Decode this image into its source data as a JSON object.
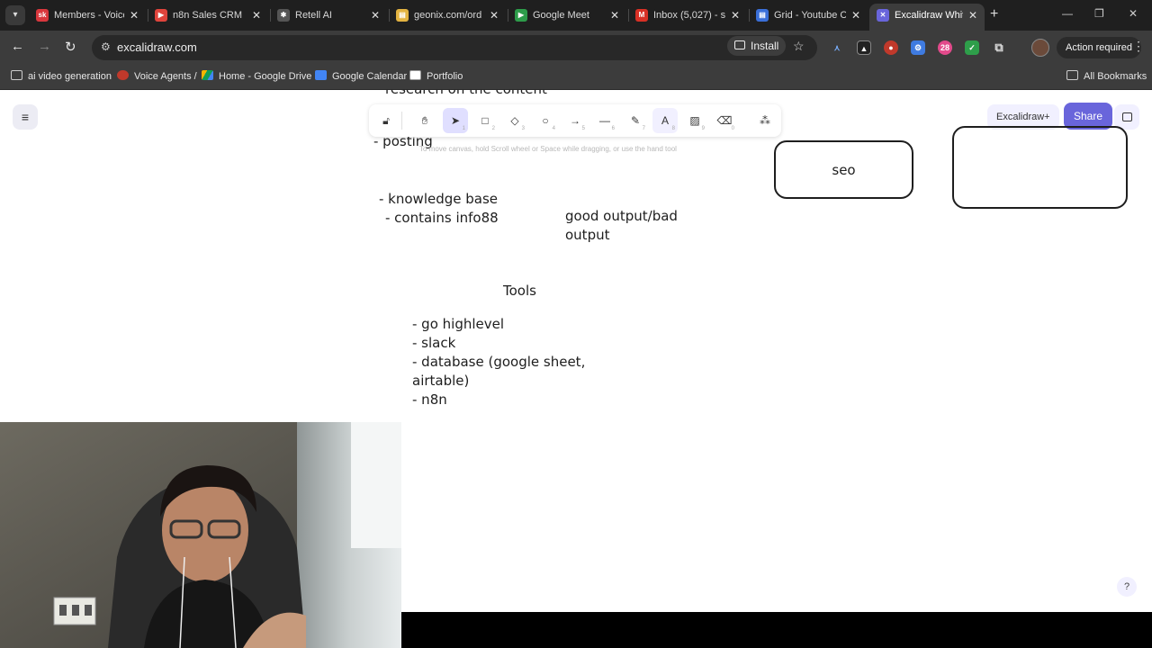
{
  "browser": {
    "tabs": [
      {
        "title": "Members - Voice",
        "icon": "skool-icon",
        "color": "#d9373d",
        "glyph": "sk"
      },
      {
        "title": "n8n Sales CRM",
        "icon": "youtube-icon",
        "color": "#e0443c",
        "glyph": "▶"
      },
      {
        "title": "Retell AI",
        "icon": "retell-icon",
        "color": "#555555",
        "glyph": "✱"
      },
      {
        "title": "geonix.com/ord",
        "icon": "doc-icon",
        "color": "#e3b341",
        "glyph": "▤"
      },
      {
        "title": "Google Meet",
        "icon": "meet-icon",
        "color": "#2d9c4a",
        "glyph": "▶"
      },
      {
        "title": "Inbox (5,027) - s",
        "icon": "gmail-icon",
        "color": "#d93025",
        "glyph": "M"
      },
      {
        "title": "Grid - Youtube C",
        "icon": "sheets-icon",
        "color": "#3a6fd8",
        "glyph": "▤"
      },
      {
        "title": "Excalidraw White",
        "icon": "excalidraw-icon",
        "color": "#6965db",
        "glyph": "✕"
      }
    ],
    "new_tab": "+",
    "url": "excalidraw.com",
    "install_label": "Install",
    "action_required": "Action required",
    "bookmarks": [
      {
        "label": "ai video generation",
        "icon": "folder-icon"
      },
      {
        "label": "Voice Agents /",
        "icon": "spark-icon"
      },
      {
        "label": "Home - Google Drive",
        "icon": "drive-icon"
      },
      {
        "label": "Google Calendar",
        "icon": "calendar-icon"
      },
      {
        "label": "Portfolio",
        "icon": "notion-icon"
      }
    ],
    "all_bookmarks": "All Bookmarks"
  },
  "excalidraw": {
    "hint": "To move canvas, hold Scroll wheel or Space while dragging, or use the hand tool",
    "tools": [
      {
        "name": "lock",
        "glyph": "🔓︎",
        "key": ""
      },
      {
        "name": "hand",
        "glyph": "✋︎",
        "key": ""
      },
      {
        "name": "selection",
        "glyph": "➤",
        "key": "1"
      },
      {
        "name": "rectangle",
        "glyph": "□",
        "key": "2"
      },
      {
        "name": "diamond",
        "glyph": "◇",
        "key": "3"
      },
      {
        "name": "ellipse",
        "glyph": "○",
        "key": "4"
      },
      {
        "name": "arrow",
        "glyph": "→",
        "key": "5"
      },
      {
        "name": "line",
        "glyph": "—",
        "key": "6"
      },
      {
        "name": "draw",
        "glyph": "✎",
        "key": "7"
      },
      {
        "name": "text",
        "glyph": "A",
        "key": "8"
      },
      {
        "name": "image",
        "glyph": "▨",
        "key": "9"
      },
      {
        "name": "eraser",
        "glyph": "⌫",
        "key": "0"
      },
      {
        "name": "extra",
        "glyph": "⁂",
        "key": ""
      }
    ],
    "excalidraw_plus": "Excalidraw+",
    "share": "Share",
    "help": "?",
    "canvas_text": {
      "research": "research on the content",
      "posting": "- posting",
      "knowledge_base": "- knowledge base",
      "contains": "- contains info88",
      "good_output": "good output/bad",
      "good_output_2": "output",
      "tools_title": "Tools",
      "tool_1": "- go highlevel",
      "tool_2": "- slack",
      "tool_3": "- database (google sheet,",
      "tool_3b": "airtable)",
      "tool_4": "- n8n",
      "seo": "seo"
    }
  }
}
